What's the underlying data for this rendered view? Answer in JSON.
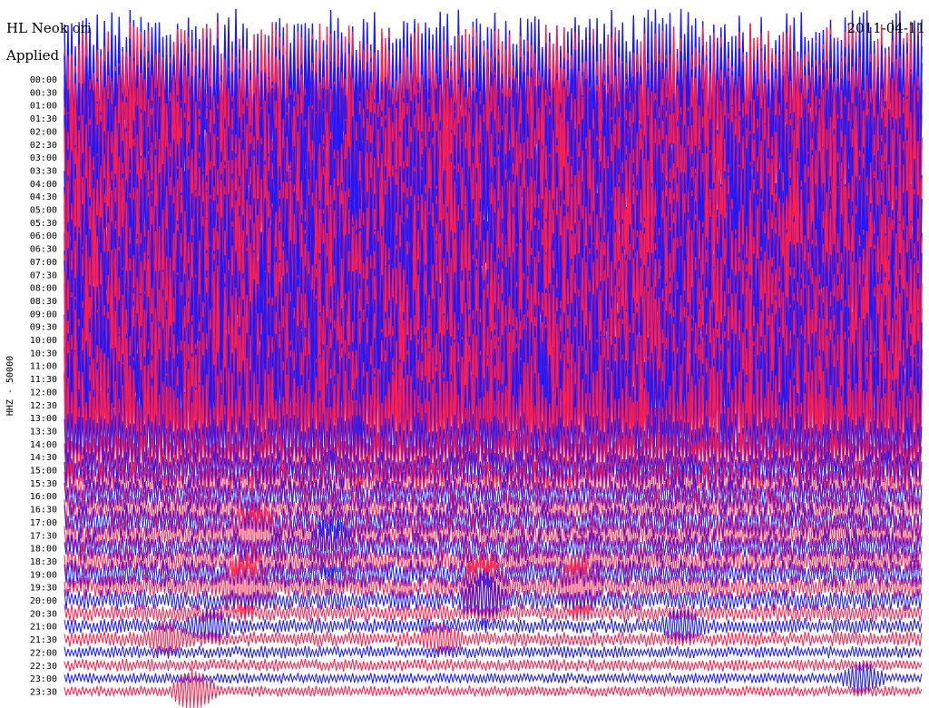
{
  "header": {
    "station": "HL Neok ori",
    "filter": "Applied",
    "date": "2011-04-11"
  },
  "colors": {
    "series_a": "#1a1aff",
    "series_b": "#ff1f4b",
    "background": "#ffffff",
    "text": "#000000"
  },
  "chart_data": {
    "type": "line",
    "title": "HL Neok ori",
    "ylabel": "HHZ - 50000",
    "xlabel": "",
    "grid": false,
    "tick_labels": [
      "00:00",
      "00:30",
      "01:00",
      "01:30",
      "02:00",
      "02:30",
      "03:00",
      "03:30",
      "04:00",
      "04:30",
      "05:00",
      "05:30",
      "06:00",
      "06:30",
      "07:00",
      "07:30",
      "08:00",
      "08:30",
      "09:00",
      "09:30",
      "10:00",
      "10:30",
      "11:00",
      "11:30",
      "12:00",
      "12:30",
      "13:00",
      "13:30",
      "14:00",
      "14:30",
      "15:00",
      "15:30",
      "16:00",
      "16:30",
      "17:00",
      "17:30",
      "18:00",
      "18:30",
      "19:00",
      "19:30",
      "20:00",
      "20:30",
      "21:00",
      "21:30",
      "22:00",
      "22:30",
      "23:00",
      "23:30"
    ],
    "trace_colors": [
      "#1a1aff",
      "#ff1f4b"
    ],
    "relative_amplitude": [
      9,
      9,
      9,
      9,
      9,
      9,
      9,
      9,
      9,
      9,
      9,
      9,
      9,
      9,
      9,
      9,
      9,
      9,
      9,
      9,
      9,
      9,
      9,
      9,
      9,
      9,
      9,
      8,
      4,
      3,
      2.5,
      2.5,
      2.2,
      2.2,
      2.2,
      2.2,
      2,
      2,
      1.8,
      1.6,
      1.4,
      1.2,
      1,
      1,
      0.8,
      0.8,
      0.7,
      0.7
    ],
    "events": [
      {
        "row": 39,
        "x_fraction": 0.21,
        "amplitude": 4
      },
      {
        "row": 39,
        "x_fraction": 0.49,
        "amplitude": 5
      },
      {
        "row": 39,
        "x_fraction": 0.6,
        "amplitude": 4
      },
      {
        "row": 40,
        "x_fraction": 0.49,
        "amplitude": 3
      },
      {
        "row": 36,
        "x_fraction": 0.31,
        "amplitude": 3
      },
      {
        "row": 35,
        "x_fraction": 0.22,
        "amplitude": 3
      },
      {
        "row": 42,
        "x_fraction": 0.17,
        "amplitude": 2
      },
      {
        "row": 42,
        "x_fraction": 0.72,
        "amplitude": 2
      },
      {
        "row": 43,
        "x_fraction": 0.12,
        "amplitude": 2
      },
      {
        "row": 43,
        "x_fraction": 0.44,
        "amplitude": 2
      },
      {
        "row": 46,
        "x_fraction": 0.93,
        "amplitude": 2
      },
      {
        "row": 47,
        "x_fraction": 0.15,
        "amplitude": 3
      }
    ]
  }
}
